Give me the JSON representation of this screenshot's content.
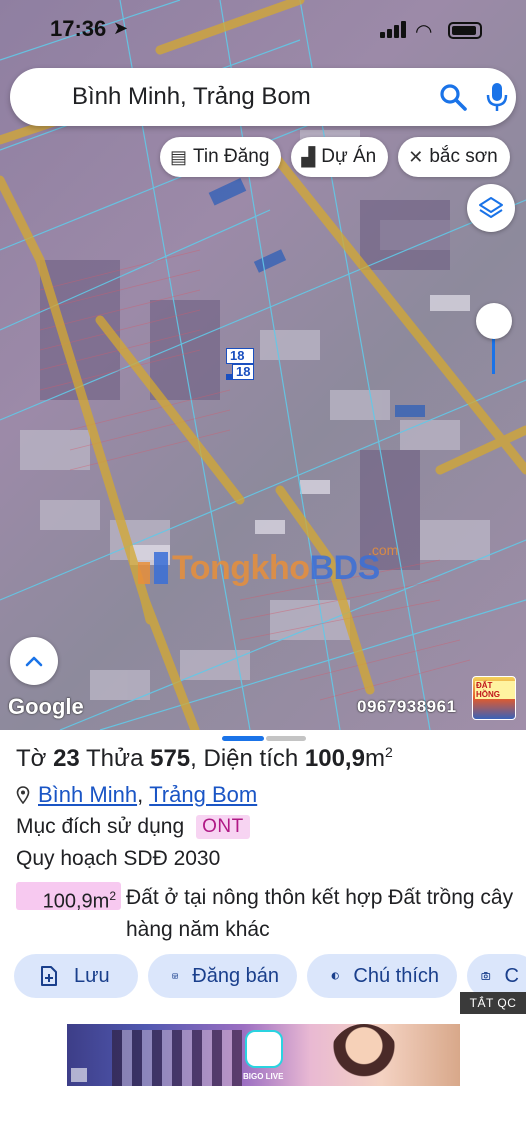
{
  "status_bar": {
    "time": "17:36"
  },
  "search": {
    "value": "Bình Minh, Trảng Bom"
  },
  "chips": [
    {
      "label": "Tin Đăng",
      "icon": "listing-icon"
    },
    {
      "label": "Dự Án",
      "icon": "building-icon"
    },
    {
      "label": "bắc sơn",
      "icon": "tools-icon"
    }
  ],
  "map": {
    "plot_numbers": [
      "18",
      "18"
    ],
    "watermark": {
      "brand_part1": "Tongkho",
      "brand_part2": "BDS",
      "suffix": ".com"
    },
    "attribution": "Google",
    "phone": "0967938961",
    "ad_thumb_text": "ĐẤT HỒNG"
  },
  "details": {
    "sheet_label": "Tờ",
    "sheet_number": "23",
    "parcel_label": "Thửa",
    "parcel_number": "575",
    "area_label": "Diện tích",
    "area_value": "100,9",
    "area_unit": "m",
    "area_unit_exp": "2",
    "ward": "Bình Minh",
    "district": "Trảng Bom",
    "purpose_label": "Mục đích sử dụng",
    "purpose_code": "ONT",
    "plan_label": "Quy hoạch SDĐ 2030",
    "plan_area": "100,9m",
    "plan_area_exp": "2",
    "plan_description": "Đất ở tại nông thôn kết hợp Đất trồng cây hàng năm khác"
  },
  "actions": [
    {
      "label": "Lưu",
      "icon": "save-icon"
    },
    {
      "label": "Đăng bán",
      "icon": "calendar-icon"
    },
    {
      "label": "Chú thích",
      "icon": "contrast-icon"
    },
    {
      "label": "C",
      "icon": "camera-icon"
    }
  ],
  "ads": {
    "close_label": "TẮT QC",
    "banner_brand": "BIGO LIVE"
  },
  "colors": {
    "accent": "#1a73e8",
    "chip_bg": "#dbe6fb",
    "ont_tag_bg": "#f7d4f2",
    "area_pill_bg": "#f7c9f0",
    "boundary": "#d4a830"
  }
}
